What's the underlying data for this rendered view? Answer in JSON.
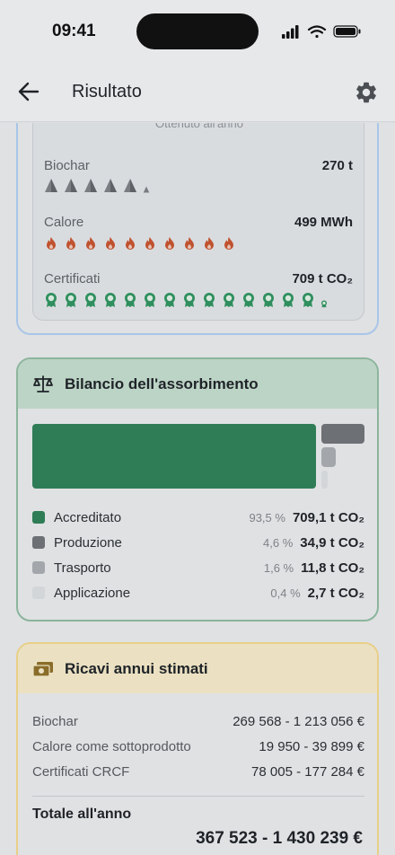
{
  "status_bar": {
    "time": "09:41"
  },
  "app_bar": {
    "title": "Risultato"
  },
  "output_card": {
    "cut_heading": "Ottenuto all'anno",
    "biochar": {
      "label": "Biochar",
      "value": "270 t"
    },
    "heat": {
      "label": "Calore",
      "value": "499 MWh"
    },
    "certificates": {
      "label": "Certificati",
      "value": "709 t CO₂"
    }
  },
  "balance_card": {
    "title": "Bilancio dell'assorbimento",
    "chart_data": {
      "type": "bar",
      "categories": [
        "Accreditato",
        "Produzione",
        "Trasporto",
        "Applicazione"
      ],
      "values": [
        709.1,
        34.9,
        11.8,
        2.7
      ],
      "percent": [
        93.5,
        4.6,
        1.6,
        0.4
      ]
    },
    "legend": [
      {
        "label": "Accreditato",
        "pct": "93,5 %",
        "value": "709,1 t CO₂",
        "color": "#2f7d56"
      },
      {
        "label": "Produzione",
        "pct": "4,6 %",
        "value": "34,9 t CO₂",
        "color": "#6d7075"
      },
      {
        "label": "Trasporto",
        "pct": "1,6 %",
        "value": "11,8 t CO₂",
        "color": "#a3a7ab"
      },
      {
        "label": "Applicazione",
        "pct": "0,4 %",
        "value": "2,7 t CO₂",
        "color": "#d3d6d9"
      }
    ]
  },
  "revenue_card": {
    "title": "Ricavi annui stimati",
    "rows": [
      {
        "label": "Biochar",
        "value": "269 568 - 1 213 056 €"
      },
      {
        "label": "Calore come sottoprodotto",
        "value": "19 950 - 39 899 €"
      },
      {
        "label": "Certificati CRCF",
        "value": "78 005 - 177 284 €"
      }
    ],
    "total_label": "Totale all'anno",
    "total_value": "367 523 - 1 430 239 €"
  },
  "colors": {
    "accent_green": "#2f7d56",
    "flame": "#c0522f",
    "certificate": "#2f8f5e"
  },
  "icons": [
    "back-arrow-icon",
    "gear-icon",
    "pile-icon",
    "flame-icon",
    "certificate-icon",
    "balance-scale-icon",
    "money-icon"
  ]
}
